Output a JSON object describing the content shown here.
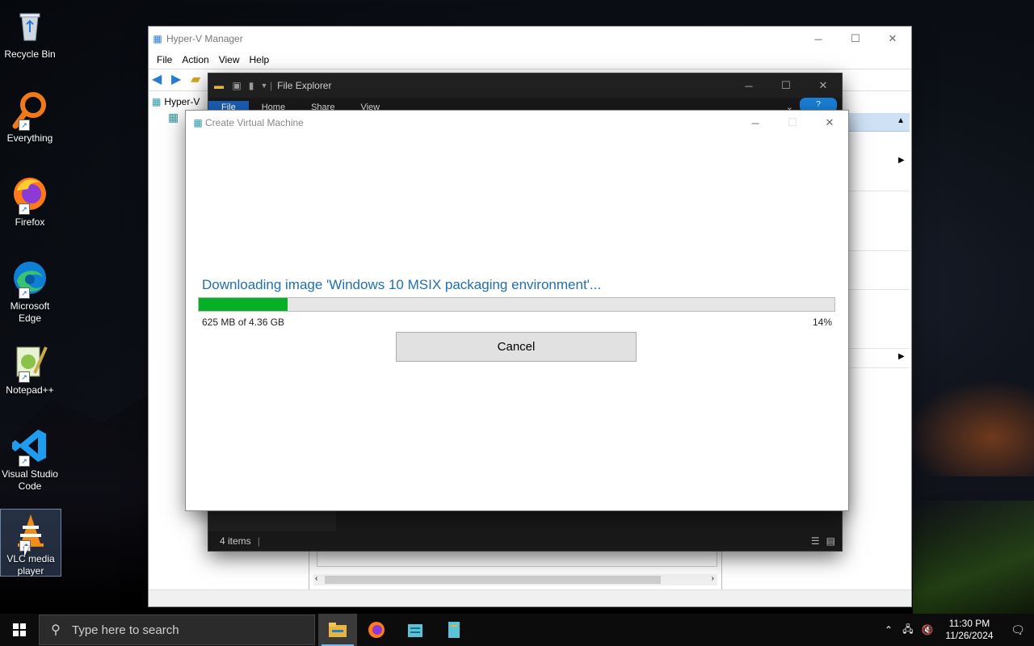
{
  "desktop": {
    "icons": [
      {
        "label": "Recycle Bin"
      },
      {
        "label": "Everything"
      },
      {
        "label": "Firefox"
      },
      {
        "label": "Microsoft Edge"
      },
      {
        "label": "Notepad++"
      },
      {
        "label": "Visual Studio Code"
      },
      {
        "label": "VLC media player"
      }
    ]
  },
  "hyperv": {
    "title": "Hyper-V Manager",
    "menu": [
      "File",
      "Action",
      "View",
      "Help"
    ],
    "tree_root": "Hyper-V"
  },
  "explorer": {
    "title": "File Explorer",
    "ribbon_tabs": [
      "File",
      "Home",
      "Share",
      "View"
    ],
    "status_items": "4 items"
  },
  "dialog": {
    "title": "Create Virtual Machine",
    "progress_title": "Downloading image 'Windows 10 MSIX packaging environment'...",
    "progress_downloaded": "625 MB of 4.36 GB",
    "progress_percent_label": "14%",
    "progress_fraction": 0.14,
    "cancel_label": "Cancel"
  },
  "taskbar": {
    "search_placeholder": "Type here to search",
    "time": "11:30 PM",
    "date": "11/26/2024"
  },
  "colors": {
    "accent": "#1a5fb4",
    "progress": "#06b025",
    "progress_text": "#1f6fb2"
  }
}
